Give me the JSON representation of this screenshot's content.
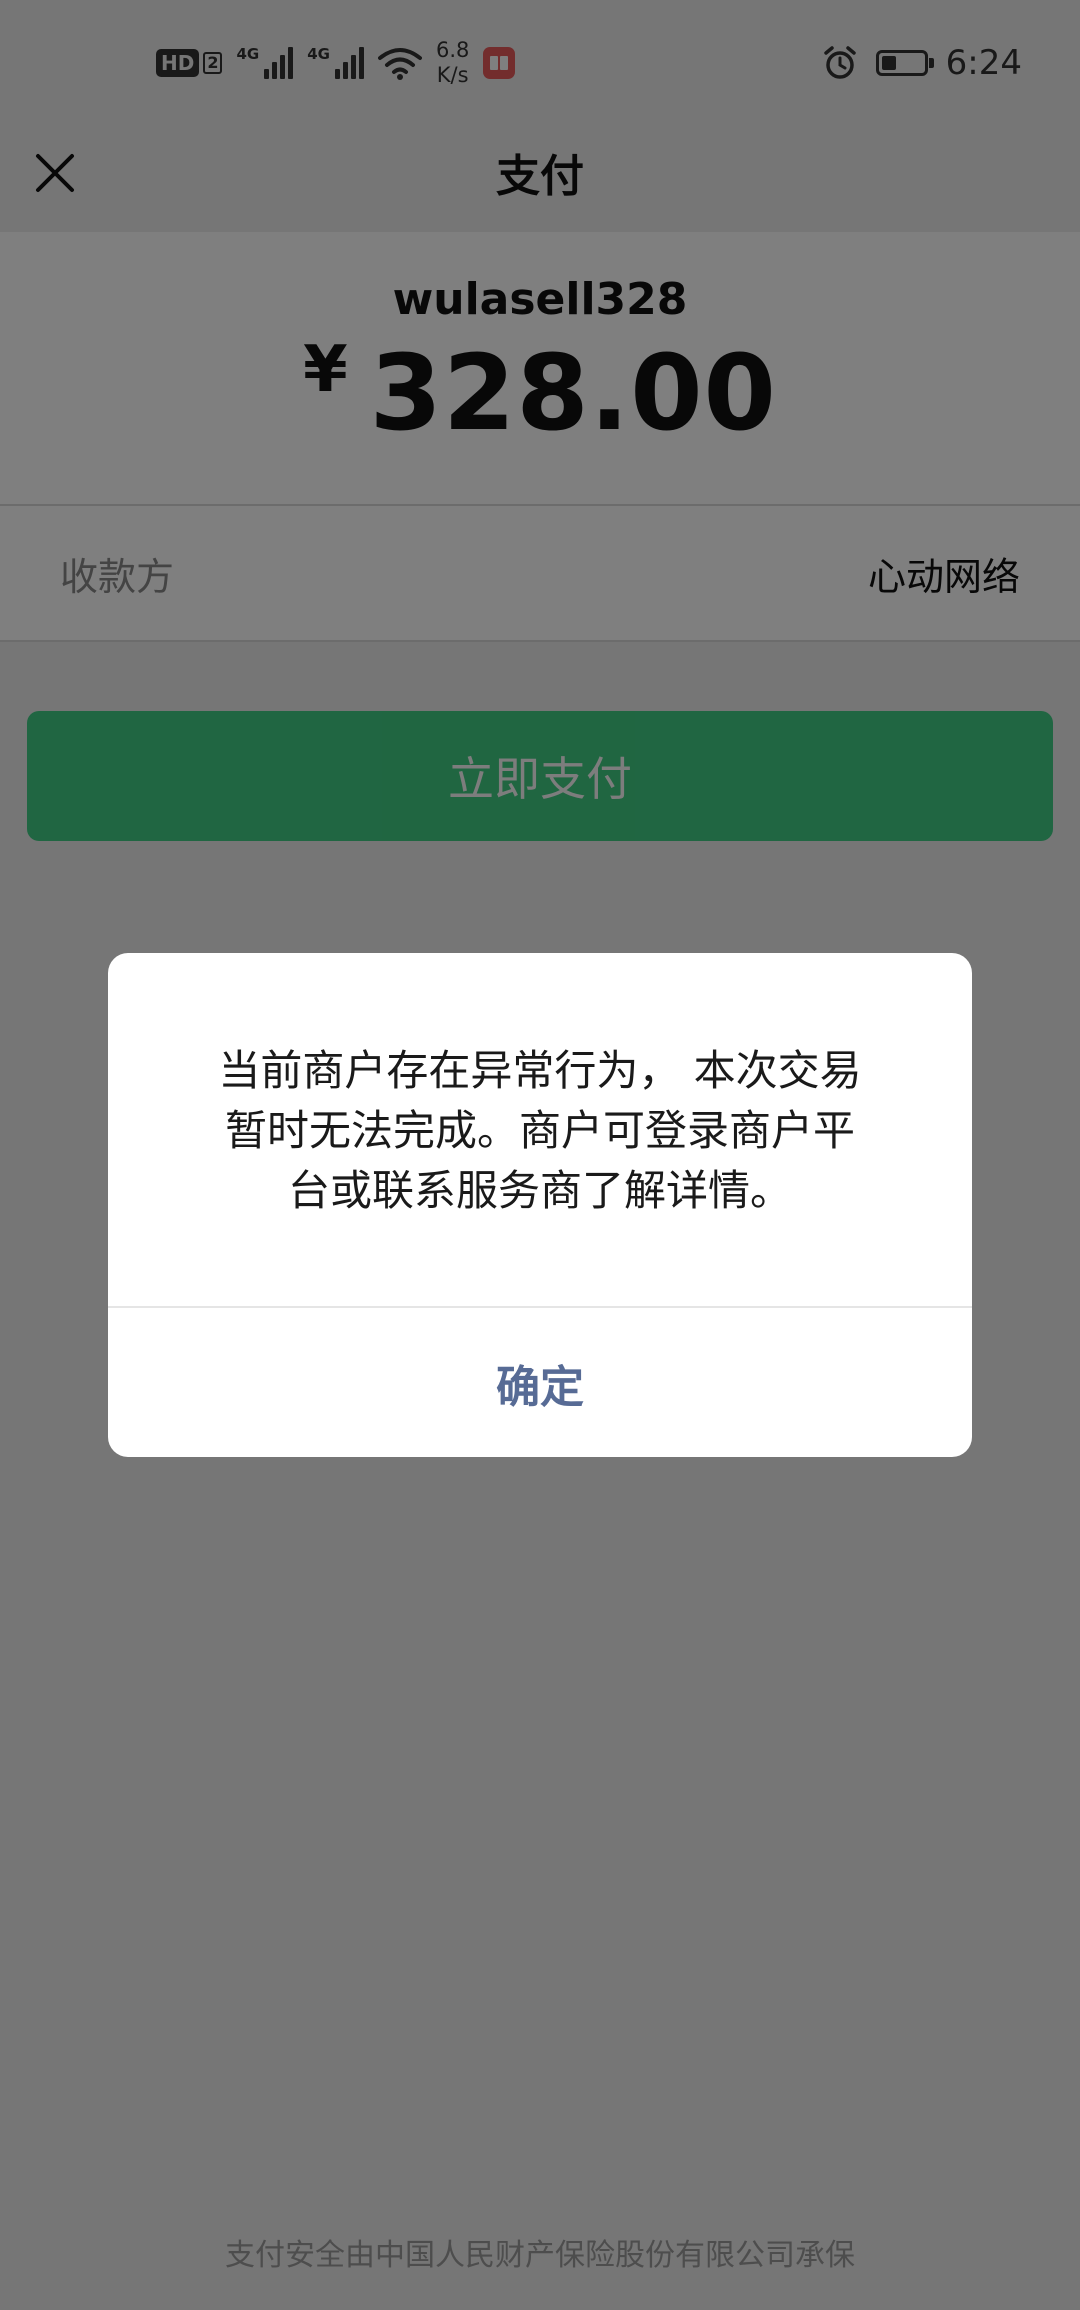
{
  "status_bar": {
    "hd_label": "HD",
    "hd_sub": "2",
    "net1": "4G",
    "net2": "4G",
    "speed_value": "6.8",
    "speed_unit": "K/s",
    "time": "6:24",
    "battery_level": 0.45
  },
  "nav": {
    "title": "支付",
    "close_icon": "close-icon"
  },
  "payment": {
    "merchant_id": "wulasell328",
    "currency_symbol": "¥",
    "amount": "328.00",
    "payee_label": "收款方",
    "payee_value": "心动网络",
    "pay_button_label": "立即支付"
  },
  "footer": {
    "note": "支付安全由中国人民财产保险股份有限公司承保"
  },
  "dialog": {
    "line1": "当前商户存在异常行为， 本次交易",
    "line2": "暂时无法完成。商户可登录商户平",
    "line3": "台或联系服务商了解详情。",
    "confirm_label": "确定"
  },
  "colors": {
    "brand_green": "#07c160",
    "link_blue": "#576b95"
  }
}
